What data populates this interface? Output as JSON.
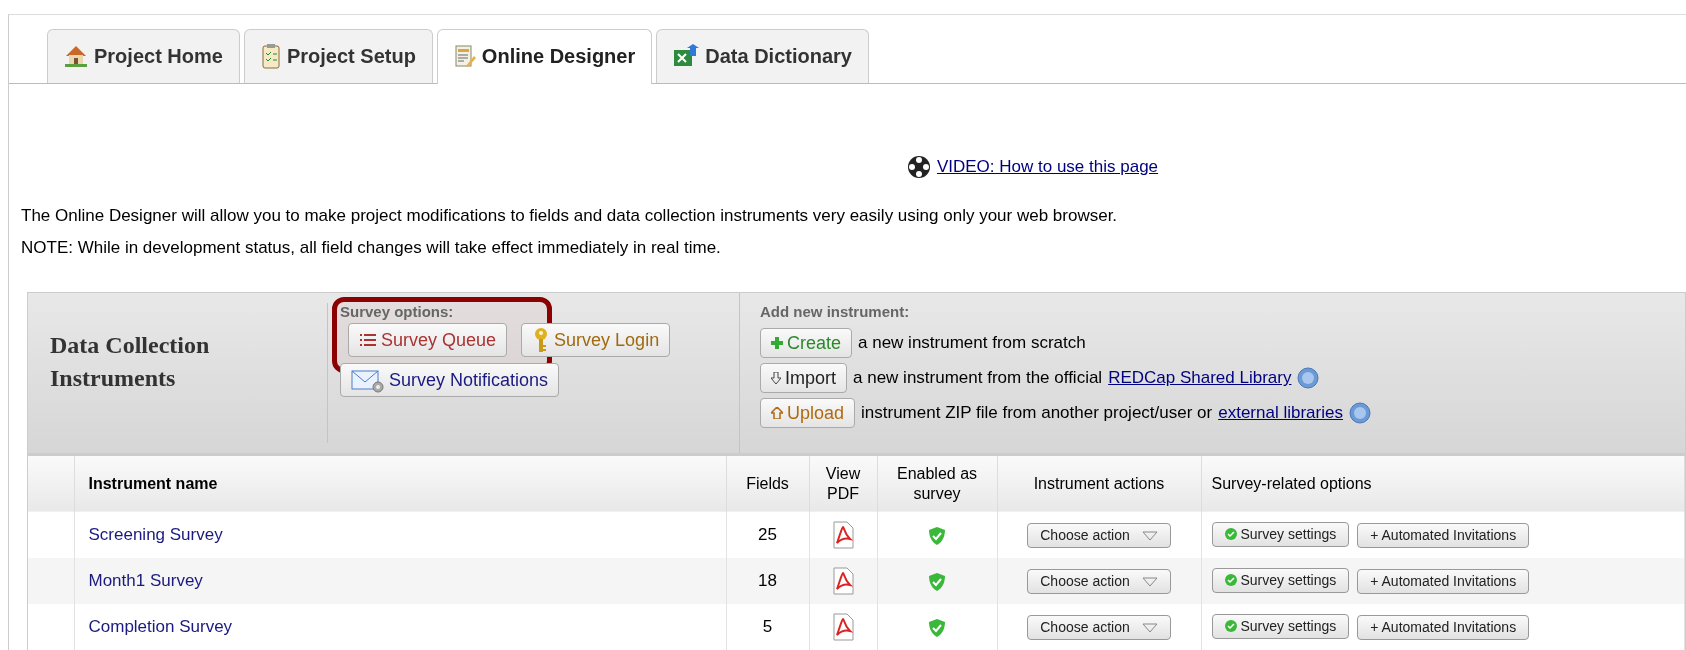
{
  "tabs": [
    {
      "label": "Project Home",
      "selected": false
    },
    {
      "label": "Project Setup",
      "selected": false
    },
    {
      "label": "Online Designer",
      "selected": true
    },
    {
      "label": "Data Dictionary",
      "selected": false
    }
  ],
  "video_link": "VIDEO: How to use this page",
  "intro": [
    "The Online Designer will allow you to make project modifications to fields and data collection instruments very easily using only your web browser.",
    "NOTE: While in development status, all field changes will take effect immediately in real time."
  ],
  "panel": {
    "title": "Data Collection Instruments",
    "survey_options": {
      "label": "Survey options:",
      "highlighted": true,
      "buttons": [
        {
          "label": "Survey Queue"
        },
        {
          "label": "Survey Login"
        },
        {
          "label": "Survey Notifications"
        }
      ]
    },
    "add_new": {
      "label": "Add new instrument:",
      "rows": [
        {
          "button": "Create",
          "text": "a new instrument from scratch"
        },
        {
          "button": "Import",
          "text": "a new instrument from the official",
          "link": "REDCap Shared Library",
          "help": true
        },
        {
          "button": "Upload",
          "text": "instrument ZIP file from another project/user or",
          "link": "external libraries",
          "help": true
        }
      ]
    }
  },
  "table": {
    "columns": [
      "Instrument name",
      "Fields",
      "View PDF",
      "Enabled as survey",
      "Instrument actions",
      "Survey-related options"
    ],
    "rows": [
      {
        "name": "Screening Survey",
        "fields": "25",
        "enabled": true,
        "action": "Choose action",
        "settings": "Survey settings",
        "invitations": "+ Automated Invitations"
      },
      {
        "name": "Month1 Survey",
        "fields": "18",
        "enabled": true,
        "action": "Choose action",
        "settings": "Survey settings",
        "invitations": "+ Automated Invitations"
      },
      {
        "name": "Completion Survey",
        "fields": "5",
        "enabled": true,
        "action": "Choose action",
        "settings": "Survey settings",
        "invitations": "+ Automated Invitations"
      }
    ]
  }
}
